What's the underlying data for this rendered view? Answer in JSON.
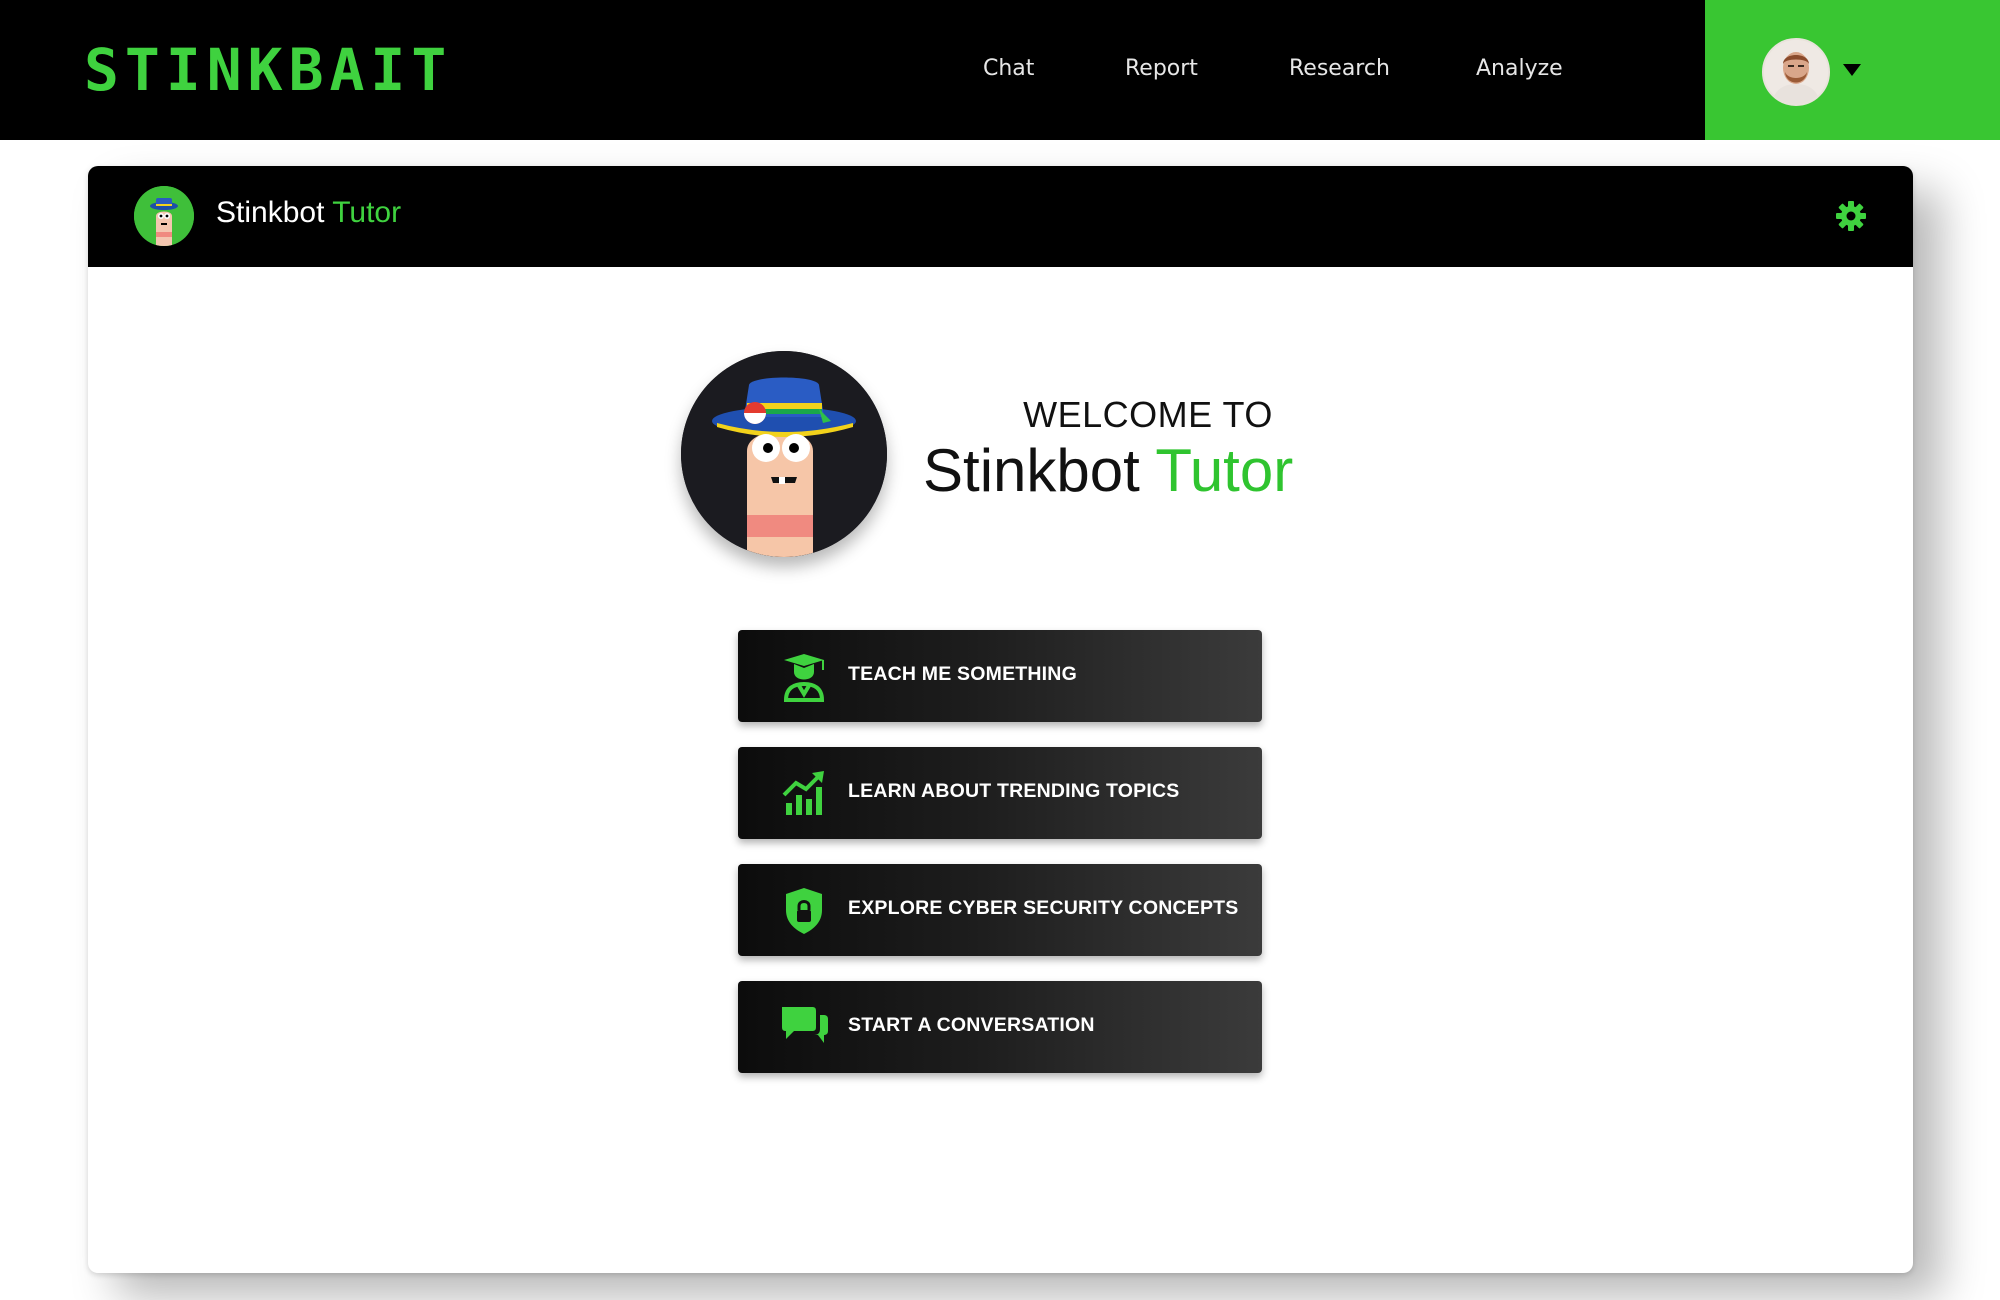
{
  "topbar": {
    "brand": "STINKBAIT",
    "nav": [
      "Chat",
      "Report",
      "Research",
      "Analyze"
    ]
  },
  "user_menu": {
    "avatar_icon": "user-avatar",
    "caret_icon": "caret-down-icon"
  },
  "card_header": {
    "title_main": "Stinkbot",
    "title_accent": "Tutor",
    "settings_icon": "gear-icon"
  },
  "hero": {
    "welcome_line": "WELCOME TO",
    "title_main": "Stinkbot",
    "title_accent": "Tutor"
  },
  "actions": [
    {
      "label": "TEACH ME SOMETHING",
      "icon": "graduate-icon"
    },
    {
      "label": "LEARN ABOUT TRENDING TOPICS",
      "icon": "trending-chart-icon"
    },
    {
      "label": "EXPLORE CYBER SECURITY CONCEPTS",
      "icon": "shield-lock-icon"
    },
    {
      "label": "START A CONVERSATION",
      "icon": "chat-bubbles-icon"
    }
  ],
  "colors": {
    "accent": "#3fd23f",
    "user_box": "#39c632",
    "nav_bg": "#000000"
  }
}
